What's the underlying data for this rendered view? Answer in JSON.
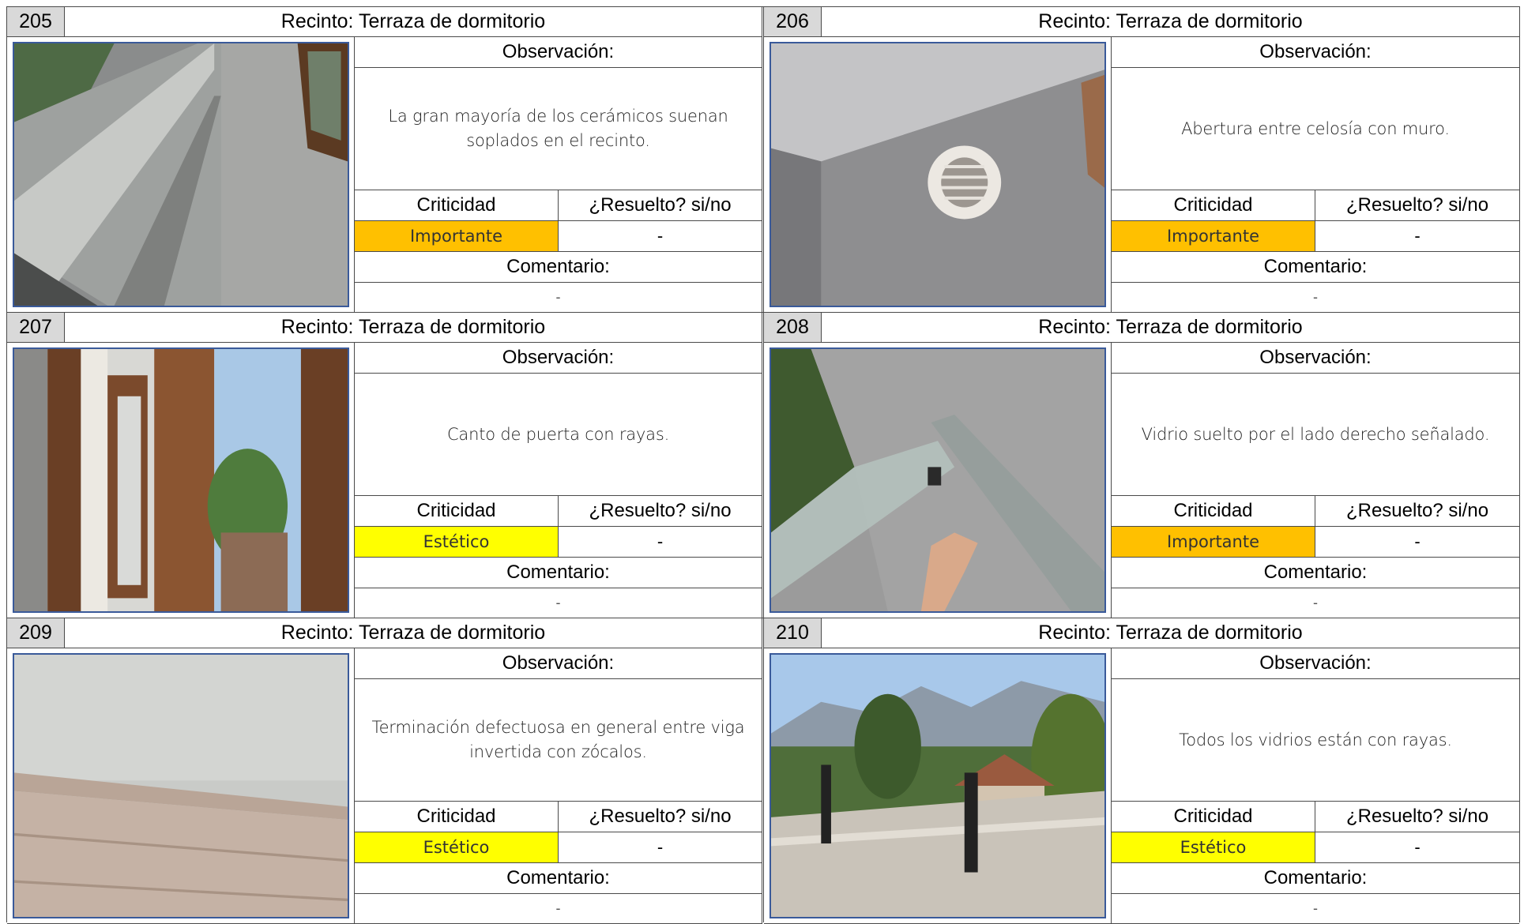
{
  "labels": {
    "observacion": "Observación:",
    "criticidad": "Criticidad",
    "resuelto": "¿Resuelto? si/no",
    "comentario": "Comentario:"
  },
  "colors": {
    "importante": "#ffc000",
    "estetico": "#ffff00",
    "header_gray": "#d9d9d9"
  },
  "items": [
    {
      "number": "205",
      "title": "Recinto: Terraza de dormitorio",
      "observation": "La gran mayoría de los cerámicos suenan soplados en el recinto.",
      "criticality": "Importante",
      "resolved": "-",
      "comment": "-"
    },
    {
      "number": "206",
      "title": "Recinto: Terraza de dormitorio",
      "observation": "Abertura entre celosía con muro.",
      "criticality": "Importante",
      "resolved": "-",
      "comment": "-"
    },
    {
      "number": "207",
      "title": "Recinto: Terraza de dormitorio",
      "observation": "Canto de puerta con rayas.",
      "criticality": "Estético",
      "resolved": "-",
      "comment": "-"
    },
    {
      "number": "208",
      "title": "Recinto: Terraza de dormitorio",
      "observation": "Vidrio suelto por el lado derecho señalado.",
      "criticality": "Importante",
      "resolved": "-",
      "comment": "-"
    },
    {
      "number": "209",
      "title": "Recinto: Terraza de dormitorio",
      "observation": "Terminación defectuosa en general entre viga invertida con zócalos.",
      "criticality": "Estético",
      "resolved": "-",
      "comment": "-"
    },
    {
      "number": "210",
      "title": "Recinto: Terraza de dormitorio",
      "observation": "Todos los vidrios están con rayas.",
      "criticality": "Estético",
      "resolved": "-",
      "comment": "-"
    }
  ]
}
